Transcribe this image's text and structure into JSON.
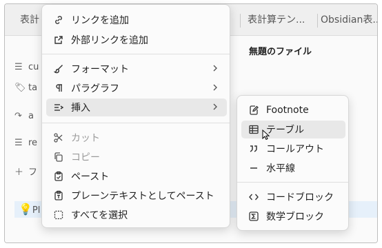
{
  "tabs": [
    {
      "label": "表計"
    },
    {
      "label": "表計算テン..."
    },
    {
      "label": "Obsidian表..."
    }
  ],
  "editor": {
    "file_title": "無題のファイル",
    "sidebar": [
      {
        "icon": "lines-icon",
        "text": "cu"
      },
      {
        "icon": "tag-icon",
        "text": "ta"
      },
      {
        "icon": "redo-arrow-icon",
        "text": "a"
      },
      {
        "icon": "lines-icon",
        "text": "re"
      },
      {
        "icon": "plus-icon",
        "text": "フ"
      }
    ],
    "callout_text": "Pl"
  },
  "context_menu": {
    "items": [
      {
        "label": "リンクを追加",
        "icon": "link-icon",
        "enabled": true
      },
      {
        "label": "外部リンクを追加",
        "icon": "external-link-icon",
        "enabled": true
      },
      {
        "label": "フォーマット",
        "icon": "paintbrush-icon",
        "enabled": true,
        "submenu": true
      },
      {
        "label": "パラグラフ",
        "icon": "pilcrow-icon",
        "enabled": true,
        "submenu": true
      },
      {
        "label": "挿入",
        "icon": "insert-icon",
        "enabled": true,
        "submenu": true,
        "highlighted": true
      },
      {
        "label": "カット",
        "icon": "scissors-icon",
        "enabled": false
      },
      {
        "label": "コピー",
        "icon": "copy-icon",
        "enabled": false
      },
      {
        "label": "ペースト",
        "icon": "clipboard-icon",
        "enabled": true
      },
      {
        "label": "プレーンテキストとしてペースト",
        "icon": "clipboard-text-icon",
        "enabled": true
      },
      {
        "label": "すべてを選択",
        "icon": "select-all-icon",
        "enabled": true
      }
    ]
  },
  "insert_submenu": {
    "items": [
      {
        "label": "Footnote",
        "icon": "footnote-icon"
      },
      {
        "label": "テーブル",
        "icon": "table-icon",
        "highlighted": true
      },
      {
        "label": "コールアウト",
        "icon": "quote-icon"
      },
      {
        "label": "水平線",
        "icon": "horizontal-rule-icon"
      },
      {
        "label": "コードブロック",
        "icon": "code-icon"
      },
      {
        "label": "数学ブロック",
        "icon": "sigma-icon"
      }
    ]
  },
  "colors": {
    "menu_bg": "#fbfbfb",
    "highlight": "#e8e8e8",
    "disabled_text": "#9a9a9a"
  }
}
